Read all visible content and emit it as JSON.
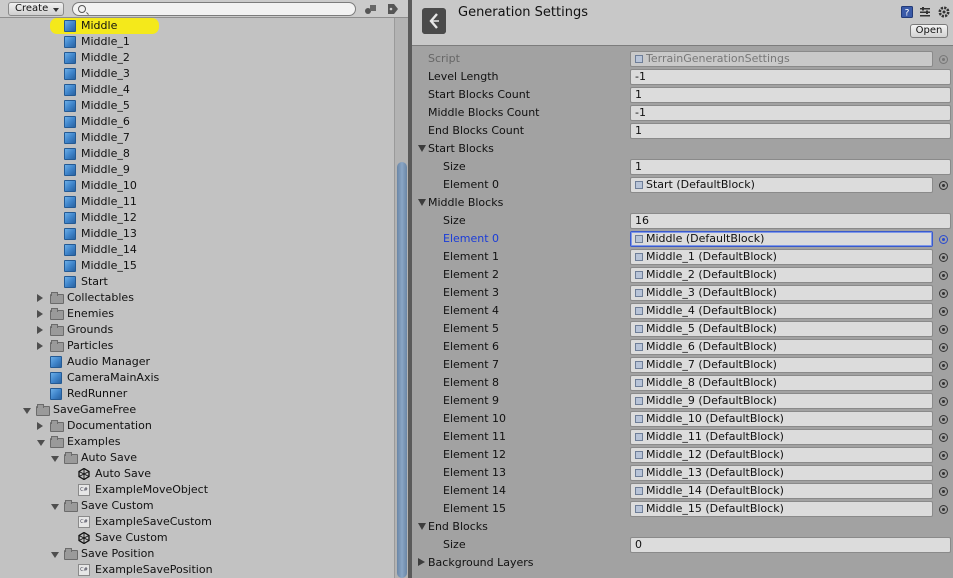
{
  "toolbar": {
    "create_label": "Create",
    "search_placeholder": ""
  },
  "tree": [
    {
      "depth": 3,
      "icon": "cube-icon",
      "label": "Middle",
      "selected": true
    },
    {
      "depth": 3,
      "icon": "cube-icon",
      "label": "Middle_1"
    },
    {
      "depth": 3,
      "icon": "cube-icon",
      "label": "Middle_2"
    },
    {
      "depth": 3,
      "icon": "cube-icon",
      "label": "Middle_3"
    },
    {
      "depth": 3,
      "icon": "cube-icon",
      "label": "Middle_4"
    },
    {
      "depth": 3,
      "icon": "cube-icon",
      "label": "Middle_5"
    },
    {
      "depth": 3,
      "icon": "cube-icon",
      "label": "Middle_6"
    },
    {
      "depth": 3,
      "icon": "cube-icon",
      "label": "Middle_7"
    },
    {
      "depth": 3,
      "icon": "cube-icon",
      "label": "Middle_8"
    },
    {
      "depth": 3,
      "icon": "cube-icon",
      "label": "Middle_9"
    },
    {
      "depth": 3,
      "icon": "cube-icon",
      "label": "Middle_10"
    },
    {
      "depth": 3,
      "icon": "cube-icon",
      "label": "Middle_11"
    },
    {
      "depth": 3,
      "icon": "cube-icon",
      "label": "Middle_12"
    },
    {
      "depth": 3,
      "icon": "cube-icon",
      "label": "Middle_13"
    },
    {
      "depth": 3,
      "icon": "cube-icon",
      "label": "Middle_14"
    },
    {
      "depth": 3,
      "icon": "cube-icon",
      "label": "Middle_15"
    },
    {
      "depth": 3,
      "icon": "cube-icon",
      "label": "Start"
    },
    {
      "depth": 2,
      "icon": "folder-icon",
      "label": "Collectables",
      "arrow": "closed"
    },
    {
      "depth": 2,
      "icon": "folder-icon",
      "label": "Enemies",
      "arrow": "closed"
    },
    {
      "depth": 2,
      "icon": "folder-icon",
      "label": "Grounds",
      "arrow": "closed"
    },
    {
      "depth": 2,
      "icon": "folder-icon",
      "label": "Particles",
      "arrow": "closed"
    },
    {
      "depth": 2,
      "icon": "cube-icon",
      "label": "Audio Manager"
    },
    {
      "depth": 2,
      "icon": "cube-icon",
      "label": "CameraMainAxis"
    },
    {
      "depth": 2,
      "icon": "cube-icon",
      "label": "RedRunner"
    },
    {
      "depth": 1,
      "icon": "folder-icon",
      "label": "SaveGameFree",
      "arrow": "open"
    },
    {
      "depth": 2,
      "icon": "folder-icon",
      "label": "Documentation",
      "arrow": "closed"
    },
    {
      "depth": 2,
      "icon": "folder-icon",
      "label": "Examples",
      "arrow": "open"
    },
    {
      "depth": 3,
      "icon": "folder-icon",
      "label": "Auto Save",
      "arrow": "open"
    },
    {
      "depth": 4,
      "icon": "unity-scene-icon",
      "label": "Auto Save"
    },
    {
      "depth": 4,
      "icon": "script-icon",
      "label": "ExampleMoveObject"
    },
    {
      "depth": 3,
      "icon": "folder-icon",
      "label": "Save Custom",
      "arrow": "open"
    },
    {
      "depth": 4,
      "icon": "script-icon",
      "label": "ExampleSaveCustom"
    },
    {
      "depth": 4,
      "icon": "unity-scene-icon",
      "label": "Save Custom"
    },
    {
      "depth": 3,
      "icon": "folder-icon",
      "label": "Save Position",
      "arrow": "open"
    },
    {
      "depth": 4,
      "icon": "script-icon",
      "label": "ExampleSavePosition"
    }
  ],
  "inspector": {
    "title": "Generation Settings",
    "open_label": "Open",
    "rows": [
      {
        "label": "Script",
        "kind": "obj",
        "value": "TerrainGenerationSettings",
        "dim": true,
        "indent": 0
      },
      {
        "label": "Level Length",
        "kind": "text",
        "value": "-1",
        "indent": 0
      },
      {
        "label": "Start Blocks Count",
        "kind": "text",
        "value": "1",
        "indent": 0
      },
      {
        "label": "Middle Blocks Count",
        "kind": "text",
        "value": "-1",
        "indent": 0
      },
      {
        "label": "End Blocks Count",
        "kind": "text",
        "value": "1",
        "indent": 0
      },
      {
        "label": "Start Blocks",
        "kind": "foldout",
        "arrow": "open",
        "indent": 0
      },
      {
        "label": "Size",
        "kind": "text",
        "value": "1",
        "indent": 1
      },
      {
        "label": "Element 0",
        "kind": "obj",
        "value": "Start (DefaultBlock)",
        "indent": 1
      },
      {
        "label": "Middle Blocks",
        "kind": "foldout",
        "arrow": "open",
        "indent": 0
      },
      {
        "label": "Size",
        "kind": "text",
        "value": "16",
        "indent": 1
      },
      {
        "label": "Element 0",
        "kind": "obj",
        "value": "Middle (DefaultBlock)",
        "indent": 1,
        "focus": true
      },
      {
        "label": "Element 1",
        "kind": "obj",
        "value": "Middle_1 (DefaultBlock)",
        "indent": 1
      },
      {
        "label": "Element 2",
        "kind": "obj",
        "value": "Middle_2 (DefaultBlock)",
        "indent": 1
      },
      {
        "label": "Element 3",
        "kind": "obj",
        "value": "Middle_3 (DefaultBlock)",
        "indent": 1
      },
      {
        "label": "Element 4",
        "kind": "obj",
        "value": "Middle_4 (DefaultBlock)",
        "indent": 1
      },
      {
        "label": "Element 5",
        "kind": "obj",
        "value": "Middle_5 (DefaultBlock)",
        "indent": 1
      },
      {
        "label": "Element 6",
        "kind": "obj",
        "value": "Middle_6 (DefaultBlock)",
        "indent": 1
      },
      {
        "label": "Element 7",
        "kind": "obj",
        "value": "Middle_7 (DefaultBlock)",
        "indent": 1
      },
      {
        "label": "Element 8",
        "kind": "obj",
        "value": "Middle_8 (DefaultBlock)",
        "indent": 1
      },
      {
        "label": "Element 9",
        "kind": "obj",
        "value": "Middle_9 (DefaultBlock)",
        "indent": 1
      },
      {
        "label": "Element 10",
        "kind": "obj",
        "value": "Middle_10 (DefaultBlock)",
        "indent": 1
      },
      {
        "label": "Element 11",
        "kind": "obj",
        "value": "Middle_11 (DefaultBlock)",
        "indent": 1
      },
      {
        "label": "Element 12",
        "kind": "obj",
        "value": "Middle_12 (DefaultBlock)",
        "indent": 1
      },
      {
        "label": "Element 13",
        "kind": "obj",
        "value": "Middle_13 (DefaultBlock)",
        "indent": 1
      },
      {
        "label": "Element 14",
        "kind": "obj",
        "value": "Middle_14 (DefaultBlock)",
        "indent": 1
      },
      {
        "label": "Element 15",
        "kind": "obj",
        "value": "Middle_15 (DefaultBlock)",
        "indent": 1
      },
      {
        "label": "End Blocks",
        "kind": "foldout",
        "arrow": "open",
        "indent": 0
      },
      {
        "label": "Size",
        "kind": "text",
        "value": "0",
        "indent": 1
      },
      {
        "label": "Background Layers",
        "kind": "foldout",
        "arrow": "closed",
        "indent": 0
      }
    ]
  },
  "colors": {
    "selection_highlight": "#f4e91b",
    "focus_label": "#1a3cd8",
    "cube_blue": "#3d82c8"
  }
}
